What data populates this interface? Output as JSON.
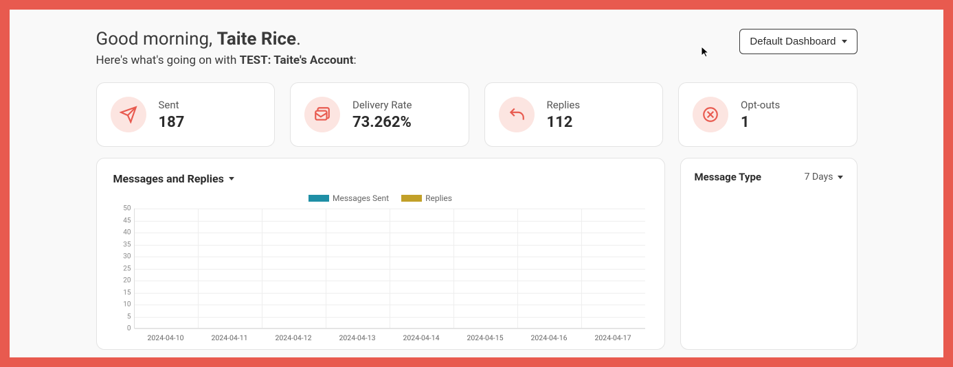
{
  "header": {
    "greeting_prefix": "Good morning, ",
    "greeting_name": "Taite Rice",
    "greeting_suffix": ".",
    "subtitle_prefix": "Here's what's going on with ",
    "subtitle_account": "TEST: Taite's Account",
    "subtitle_suffix": ":",
    "dashboard_selector": "Default Dashboard"
  },
  "stats": [
    {
      "icon": "send-icon",
      "label": "Sent",
      "value": "187"
    },
    {
      "icon": "delivery-icon",
      "label": "Delivery Rate",
      "value": "73.262%"
    },
    {
      "icon": "reply-icon",
      "label": "Replies",
      "value": "112"
    },
    {
      "icon": "optout-icon",
      "label": "Opt-outs",
      "value": "1"
    }
  ],
  "chart_panel": {
    "title": "Messages and Replies",
    "legend": {
      "series1": {
        "label": "Messages Sent",
        "color": "#1f8fa6"
      },
      "series2": {
        "label": "Replies",
        "color": "#c2a029"
      }
    }
  },
  "side_panel": {
    "title": "Message Type",
    "range": "7 Days"
  },
  "chart_data": {
    "type": "bar",
    "title": "Messages and Replies",
    "xlabel": "",
    "ylabel": "",
    "ylim": [
      0,
      50
    ],
    "y_ticks": [
      0,
      5,
      10,
      15,
      20,
      25,
      30,
      35,
      40,
      45,
      50
    ],
    "categories": [
      "2024-04-10",
      "2024-04-11",
      "2024-04-12",
      "2024-04-13",
      "2024-04-14",
      "2024-04-15",
      "2024-04-16",
      "2024-04-17"
    ],
    "series": [
      {
        "name": "Messages Sent",
        "color": "#1f8fa6",
        "values": [
          0,
          0,
          0,
          0,
          0,
          0,
          0,
          0
        ]
      },
      {
        "name": "Replies",
        "color": "#c2a029",
        "values": [
          0,
          0,
          0,
          0,
          0,
          0,
          0,
          0
        ]
      }
    ]
  }
}
